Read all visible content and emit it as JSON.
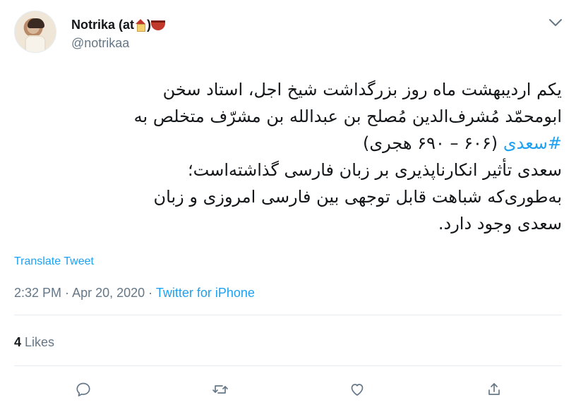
{
  "author": {
    "name": "Notrika (at",
    "handle": "@notrikaa"
  },
  "tweet": {
    "lines": [
      "یکم اردیبهشت ماه روز بزرگداشت شیخ اجل، استاد سخن",
      "ابومحمّد مُشرف‌الدین مُصلح بن عبدالله بن مشرّف متخلص به",
      "#سعدی",
      "(۶۰۶ – ۶۹۰ هجری)",
      "سعدی تأثیر انکارناپذیری بر زبان فارسی گذاشته‌است؛",
      "به‌طوری‌که شباهت قابل توجهی بین فارسی امروزی و زبان",
      "سعدی وجود دارد."
    ]
  },
  "translate_label": "Translate Tweet",
  "meta": {
    "time": "2:32 PM",
    "sep1": " · ",
    "date": "Apr 20, 2020",
    "sep2": " · ",
    "source": "Twitter for iPhone"
  },
  "likes": {
    "count": "4",
    "label": "Likes"
  },
  "icons": {
    "reply": "reply-icon",
    "retweet": "retweet-icon",
    "like": "heart-icon",
    "share": "share-icon",
    "more": "chevron-down-icon"
  },
  "colors": {
    "accent": "#1da1f2",
    "muted": "#657786",
    "text": "#14171a",
    "divider": "#e6ecf0"
  }
}
